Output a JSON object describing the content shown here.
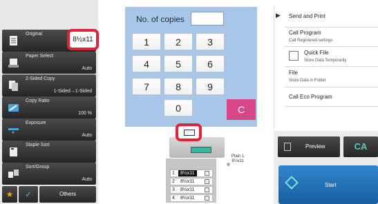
{
  "settings": [
    {
      "name": "Original",
      "value": ""
    },
    {
      "name": "Paper Select",
      "value": "Auto"
    },
    {
      "name": "2-Sided Copy",
      "value": "1-Sided→1-Sided"
    },
    {
      "name": "Copy Ratio",
      "value": "100 %"
    },
    {
      "name": "Exposure",
      "value": "Auto"
    },
    {
      "name": "Staple Sort",
      "value": ""
    },
    {
      "name": "Sort/Group",
      "value": "Auto"
    }
  ],
  "original_size": "8½x11",
  "bottom_bar": {
    "favorite_icon": "star-icon",
    "check_icon": "check-icon",
    "others_label": "Others"
  },
  "keypad": {
    "copies_label": "No. of copies",
    "copies_value": "",
    "keys": [
      "1",
      "2",
      "3",
      "4",
      "5",
      "6",
      "7",
      "8",
      "9",
      "0"
    ],
    "clear_label": "C"
  },
  "trays": [
    {
      "num": "1",
      "size": "8½x11"
    },
    {
      "num": "2",
      "size": "8½x11"
    },
    {
      "num": "3",
      "size": "8½x11"
    },
    {
      "num": "4",
      "size": "8½x11"
    }
  ],
  "bypass": {
    "type": "Plain 1",
    "size": "8½x11"
  },
  "menu": [
    {
      "title": "Send and Print",
      "sub": ""
    },
    {
      "title": "Call Program",
      "sub": "Call Registered settings"
    },
    {
      "title": "Quick File",
      "sub": "Store Data Temporarily"
    },
    {
      "title": "File",
      "sub": "Store Data in Folder"
    },
    {
      "title": "Call Eco Program",
      "sub": ""
    }
  ],
  "actions": {
    "preview_label": "Preview",
    "ca_label": "CA",
    "start_label": "Start"
  },
  "colors": {
    "accent_blue": "#2f86ce",
    "clear_pink": "#d94686",
    "highlight_red": "#e4203a",
    "keypad_bg": "#a8c7e8"
  }
}
